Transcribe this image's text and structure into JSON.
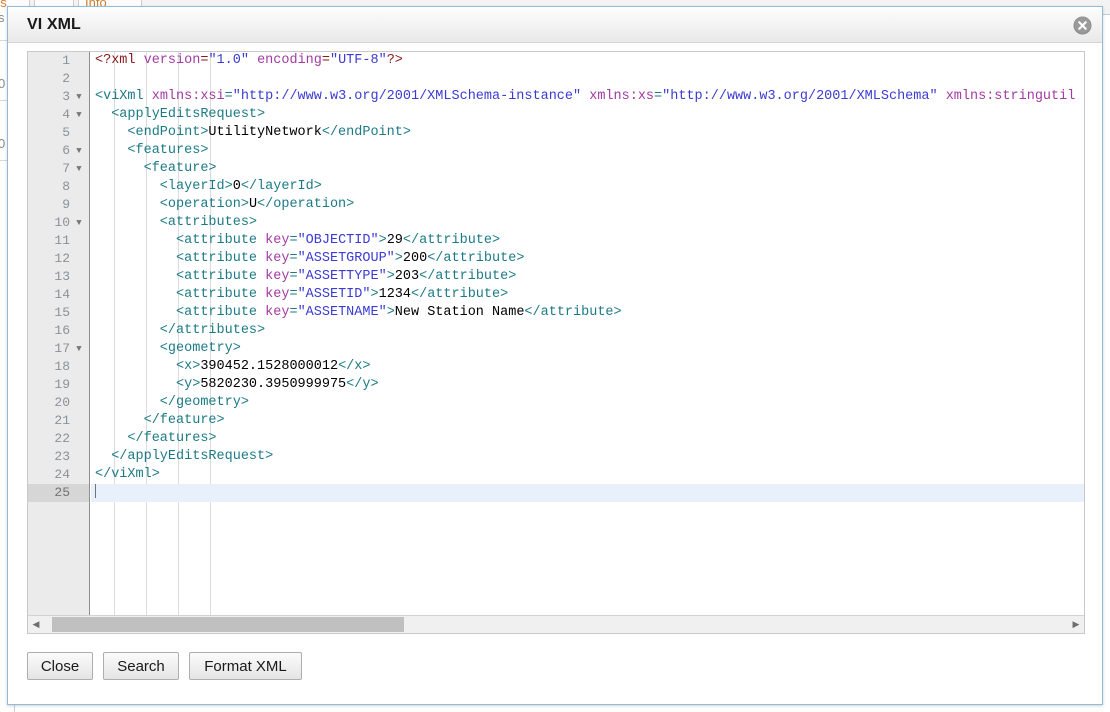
{
  "background": {
    "tabs": [
      {
        "label": "gs"
      },
      {
        "label": ""
      },
      {
        "label": "Info"
      }
    ],
    "rail_glyphs": [
      "s",
      "0",
      "0"
    ]
  },
  "dialog": {
    "title": "VI XML",
    "close_icon": "close-circle-icon",
    "close_glyph": "×"
  },
  "editor": {
    "active_line": 25,
    "fold_lines": [
      3,
      4,
      6,
      7,
      10,
      17
    ],
    "fold_glyph": "▼",
    "lines": [
      {
        "n": 1,
        "tokens": [
          {
            "t": "decl",
            "s": "<?xml "
          },
          {
            "t": "attr",
            "s": "version"
          },
          {
            "t": "decl",
            "s": "="
          },
          {
            "t": "val",
            "s": "\"1.0\""
          },
          {
            "t": "decl",
            "s": " "
          },
          {
            "t": "attr",
            "s": "encoding"
          },
          {
            "t": "decl",
            "s": "="
          },
          {
            "t": "val",
            "s": "\"UTF-8\""
          },
          {
            "t": "decl",
            "s": "?>"
          }
        ]
      },
      {
        "n": 2,
        "tokens": []
      },
      {
        "n": 3,
        "tokens": [
          {
            "t": "tag",
            "s": "<viXml "
          },
          {
            "t": "attr",
            "s": "xmlns:xsi"
          },
          {
            "t": "tag",
            "s": "="
          },
          {
            "t": "val",
            "s": "\"http://www.w3.org/2001/XMLSchema-instance\""
          },
          {
            "t": "tag",
            "s": " "
          },
          {
            "t": "attr",
            "s": "xmlns:xs"
          },
          {
            "t": "tag",
            "s": "="
          },
          {
            "t": "val",
            "s": "\"http://www.w3.org/2001/XMLSchema\""
          },
          {
            "t": "tag",
            "s": " "
          },
          {
            "t": "attr",
            "s": "xmlns:stringutil"
          }
        ]
      },
      {
        "n": 4,
        "tokens": [
          {
            "t": "tag",
            "s": "  <applyEditsRequest>"
          }
        ]
      },
      {
        "n": 5,
        "tokens": [
          {
            "t": "tag",
            "s": "    <endPoint>"
          },
          {
            "t": "txt",
            "s": "UtilityNetwork"
          },
          {
            "t": "tag",
            "s": "</endPoint>"
          }
        ]
      },
      {
        "n": 6,
        "tokens": [
          {
            "t": "tag",
            "s": "    <features>"
          }
        ]
      },
      {
        "n": 7,
        "tokens": [
          {
            "t": "tag",
            "s": "      <feature>"
          }
        ]
      },
      {
        "n": 8,
        "tokens": [
          {
            "t": "tag",
            "s": "        <layerId>"
          },
          {
            "t": "txt",
            "s": "0"
          },
          {
            "t": "tag",
            "s": "</layerId>"
          }
        ]
      },
      {
        "n": 9,
        "tokens": [
          {
            "t": "tag",
            "s": "        <operation>"
          },
          {
            "t": "txt",
            "s": "U"
          },
          {
            "t": "tag",
            "s": "</operation>"
          }
        ]
      },
      {
        "n": 10,
        "tokens": [
          {
            "t": "tag",
            "s": "        <attributes>"
          }
        ]
      },
      {
        "n": 11,
        "tokens": [
          {
            "t": "tag",
            "s": "          <attribute "
          },
          {
            "t": "attr",
            "s": "key"
          },
          {
            "t": "tag",
            "s": "="
          },
          {
            "t": "val",
            "s": "\"OBJECTID\""
          },
          {
            "t": "tag",
            "s": ">"
          },
          {
            "t": "txt",
            "s": "29"
          },
          {
            "t": "tag",
            "s": "</attribute>"
          }
        ]
      },
      {
        "n": 12,
        "tokens": [
          {
            "t": "tag",
            "s": "          <attribute "
          },
          {
            "t": "attr",
            "s": "key"
          },
          {
            "t": "tag",
            "s": "="
          },
          {
            "t": "val",
            "s": "\"ASSETGROUP\""
          },
          {
            "t": "tag",
            "s": ">"
          },
          {
            "t": "txt",
            "s": "200"
          },
          {
            "t": "tag",
            "s": "</attribute>"
          }
        ]
      },
      {
        "n": 13,
        "tokens": [
          {
            "t": "tag",
            "s": "          <attribute "
          },
          {
            "t": "attr",
            "s": "key"
          },
          {
            "t": "tag",
            "s": "="
          },
          {
            "t": "val",
            "s": "\"ASSETTYPE\""
          },
          {
            "t": "tag",
            "s": ">"
          },
          {
            "t": "txt",
            "s": "203"
          },
          {
            "t": "tag",
            "s": "</attribute>"
          }
        ]
      },
      {
        "n": 14,
        "tokens": [
          {
            "t": "tag",
            "s": "          <attribute "
          },
          {
            "t": "attr",
            "s": "key"
          },
          {
            "t": "tag",
            "s": "="
          },
          {
            "t": "val",
            "s": "\"ASSETID\""
          },
          {
            "t": "tag",
            "s": ">"
          },
          {
            "t": "txt",
            "s": "1234"
          },
          {
            "t": "tag",
            "s": "</attribute>"
          }
        ]
      },
      {
        "n": 15,
        "tokens": [
          {
            "t": "tag",
            "s": "          <attribute "
          },
          {
            "t": "attr",
            "s": "key"
          },
          {
            "t": "tag",
            "s": "="
          },
          {
            "t": "val",
            "s": "\"ASSETNAME\""
          },
          {
            "t": "tag",
            "s": ">"
          },
          {
            "t": "txt",
            "s": "New Station Name"
          },
          {
            "t": "tag",
            "s": "</attribute>"
          }
        ]
      },
      {
        "n": 16,
        "tokens": [
          {
            "t": "tag",
            "s": "        </attributes>"
          }
        ]
      },
      {
        "n": 17,
        "tokens": [
          {
            "t": "tag",
            "s": "        <geometry>"
          }
        ]
      },
      {
        "n": 18,
        "tokens": [
          {
            "t": "tag",
            "s": "          <x>"
          },
          {
            "t": "txt",
            "s": "390452.1528000012"
          },
          {
            "t": "tag",
            "s": "</x>"
          }
        ]
      },
      {
        "n": 19,
        "tokens": [
          {
            "t": "tag",
            "s": "          <y>"
          },
          {
            "t": "txt",
            "s": "5820230.3950999975"
          },
          {
            "t": "tag",
            "s": "</y>"
          }
        ]
      },
      {
        "n": 20,
        "tokens": [
          {
            "t": "tag",
            "s": "        </geometry>"
          }
        ]
      },
      {
        "n": 21,
        "tokens": [
          {
            "t": "tag",
            "s": "      </feature>"
          }
        ]
      },
      {
        "n": 22,
        "tokens": [
          {
            "t": "tag",
            "s": "    </features>"
          }
        ]
      },
      {
        "n": 23,
        "tokens": [
          {
            "t": "tag",
            "s": "  </applyEditsRequest>"
          }
        ]
      },
      {
        "n": 24,
        "tokens": [
          {
            "t": "tag",
            "s": "</viXml>"
          }
        ]
      },
      {
        "n": 25,
        "tokens": []
      }
    ],
    "scrollbar": {
      "left_arrow": "◀",
      "right_arrow": "▶"
    }
  },
  "footer": {
    "close_label": "Close",
    "search_label": "Search",
    "format_label": "Format XML"
  },
  "colors": {
    "accent_border": "#93bcd8",
    "tag": "#1c7a85",
    "attribute": "#a33aa3",
    "value": "#3b3bd4",
    "declaration": "#8b1a1a",
    "active_line": "#e8f0fb",
    "gutter": "#ebebeb"
  }
}
